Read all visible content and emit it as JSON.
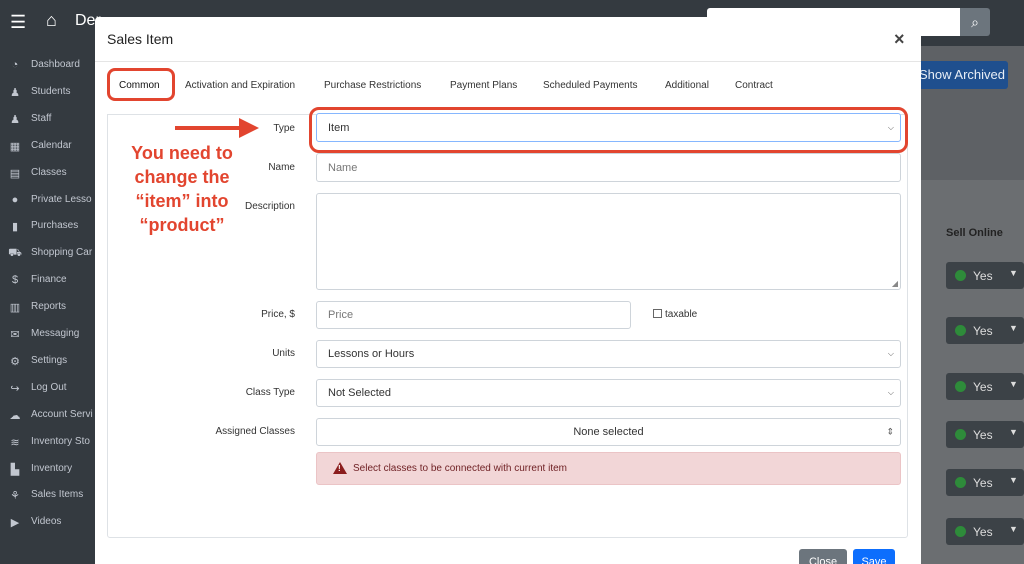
{
  "app": {
    "brand_partial": "Der",
    "search_icon": "search-icon"
  },
  "sidebar": {
    "items": [
      {
        "label": "Dashboard",
        "icon": "◔"
      },
      {
        "label": "Students",
        "icon": "♟"
      },
      {
        "label": "Staff",
        "icon": "♟"
      },
      {
        "label": "Calendar",
        "icon": "▦"
      },
      {
        "label": "Classes",
        "icon": "▤"
      },
      {
        "label": "Private Lesso",
        "icon": "●"
      },
      {
        "label": "Purchases",
        "icon": "▮"
      },
      {
        "label": "Shopping Car",
        "icon": "⛟"
      },
      {
        "label": "Finance",
        "icon": "$"
      },
      {
        "label": "Reports",
        "icon": "▥"
      },
      {
        "label": "Messaging",
        "icon": "✉"
      },
      {
        "label": "Settings",
        "icon": "⚙"
      },
      {
        "label": "Log Out",
        "icon": "↪"
      },
      {
        "label": "Account Servi",
        "icon": "☁"
      },
      {
        "label": "Inventory Sto",
        "icon": "≋"
      },
      {
        "label": "Inventory",
        "icon": "▙"
      },
      {
        "label": "Sales Items",
        "icon": "⚘"
      },
      {
        "label": "Videos",
        "icon": "▶"
      }
    ]
  },
  "background": {
    "show_archived": "Show Archived",
    "sell_online_header": "Sell Online",
    "sell_online_values": [
      "Yes",
      "Yes",
      "Yes",
      "Yes",
      "Yes",
      "Yes"
    ]
  },
  "modal": {
    "title": "Sales Item",
    "close_symbol": "×",
    "tabs": [
      "Common",
      "Activation and Expiration",
      "Purchase Restrictions",
      "Payment Plans",
      "Scheduled Payments",
      "Additional",
      "Contract"
    ],
    "active_tab": "Common",
    "form": {
      "type_label": "Type",
      "type_value": "Item",
      "name_label": "Name",
      "name_placeholder": "Name",
      "description_label": "Description",
      "price_label": "Price, $",
      "price_placeholder": "Price",
      "taxable_label": "taxable",
      "units_label": "Units",
      "units_value": "Lessons or Hours",
      "class_type_label": "Class Type",
      "class_type_value": "Not Selected",
      "assigned_classes_label": "Assigned Classes",
      "assigned_classes_value": "None selected"
    },
    "alert": {
      "message": "Select classes to be connected with current item"
    },
    "footer": {
      "close_label": "Close",
      "save_label": "Save"
    }
  },
  "annotation": {
    "note_lines": [
      "You need to",
      "change the",
      "“item” into",
      "“product”"
    ],
    "color": "#e2452f"
  }
}
